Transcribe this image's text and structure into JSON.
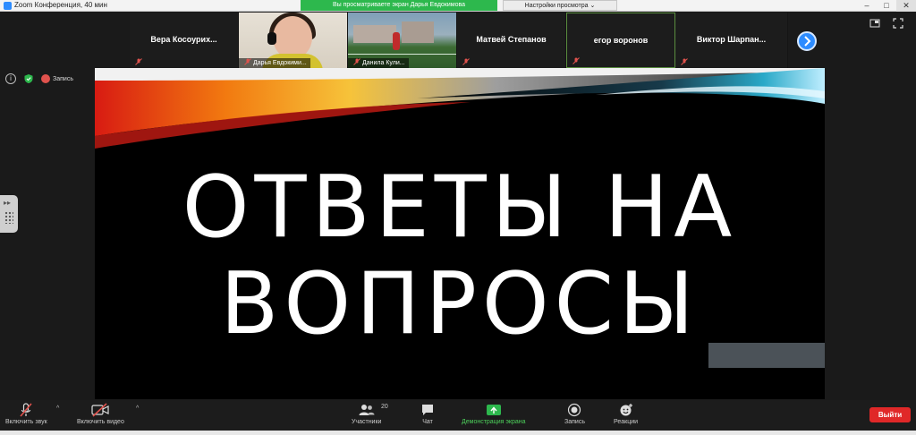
{
  "window": {
    "title": "Zoom Конференция, 40 мин"
  },
  "share_banner": "Вы просматриваете экран Дарья Евдокимова",
  "view_settings": "Настройки просмотра ⌄",
  "participants": [
    {
      "name": "Вера   Косоурих..."
    },
    {
      "name": "Дарья Евдокими..."
    },
    {
      "name": "Данила Кули..."
    },
    {
      "name": "Матвей Степанов"
    },
    {
      "name": "егор воронов"
    },
    {
      "name": "Виктор   Шарпан..."
    }
  ],
  "indicators": {
    "info": "i",
    "recording_label": "Запись"
  },
  "slide": {
    "line1": "ОТВЕТЫ НА",
    "line2": "ВОПРОСЫ"
  },
  "toolbar": {
    "audio": "Включить звук",
    "video": "Включить видео",
    "participants": "Участники",
    "participants_count": "20",
    "chat": "Чат",
    "share": "Демонстрация экрана",
    "record": "Запись",
    "reactions": "Реакции",
    "leave": "Выйти",
    "caret": "^"
  },
  "colors": {
    "accent_blue": "#2d8cff",
    "share_green": "#2db84d",
    "leave_red": "#e02828",
    "record_red": "#e0524d"
  }
}
